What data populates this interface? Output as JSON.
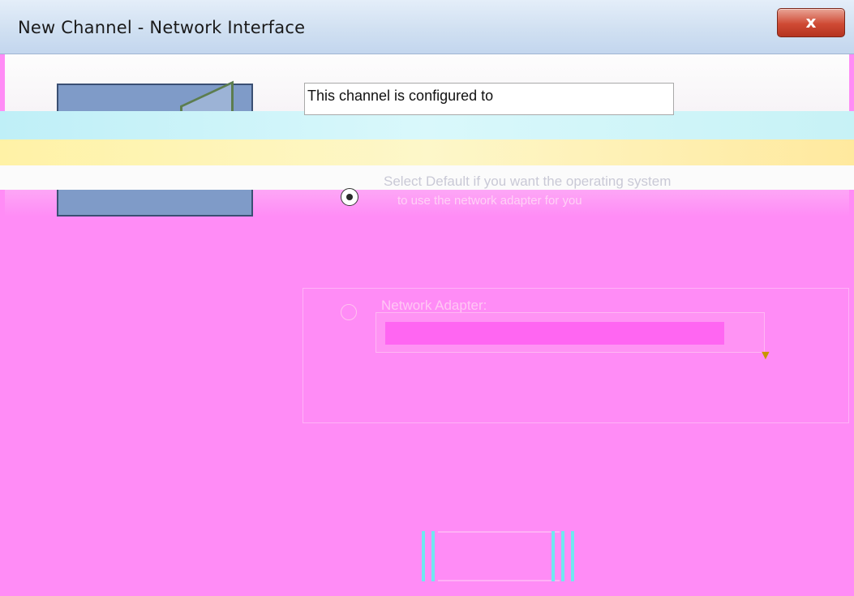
{
  "window": {
    "title": "New Channel - Network Interface",
    "close_label": "x"
  },
  "body": {
    "info_text": "This channel is configured to",
    "instruction_line1": "Select Default if you want the operating system",
    "instruction_line2": "to use the network adapter for you",
    "default_label": "",
    "adapter_label": "Network Adapter:",
    "adapter_value": ""
  },
  "buttons": {
    "back_label": "",
    "next_label": "",
    "cancel_label": ""
  },
  "colors": {
    "background": "#ff8cf6",
    "titlebar": "#cfdff1",
    "close_button": "#cf4a34"
  }
}
